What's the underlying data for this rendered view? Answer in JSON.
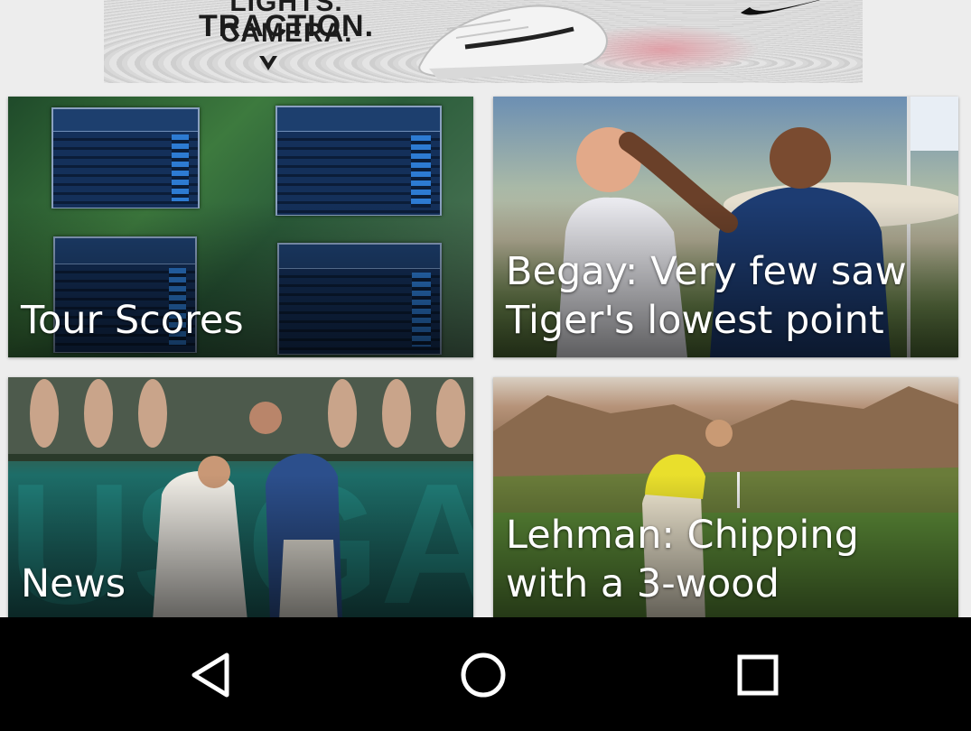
{
  "ad": {
    "headline_line1": "LIGHTS. CAMERA.",
    "headline_line2": "TRACTION.",
    "brand_icon": "swoosh-logo",
    "accent_color": "#e58a93"
  },
  "cards": [
    {
      "title": "Tour Scores"
    },
    {
      "title": "Begay: Very few saw Tiger's lowest point"
    },
    {
      "title": "News"
    },
    {
      "title": "Lehman: Chipping with a 3-wood"
    }
  ],
  "navbar": {
    "back_icon": "back-triangle-icon",
    "home_icon": "home-circle-icon",
    "recents_icon": "recents-square-icon"
  }
}
